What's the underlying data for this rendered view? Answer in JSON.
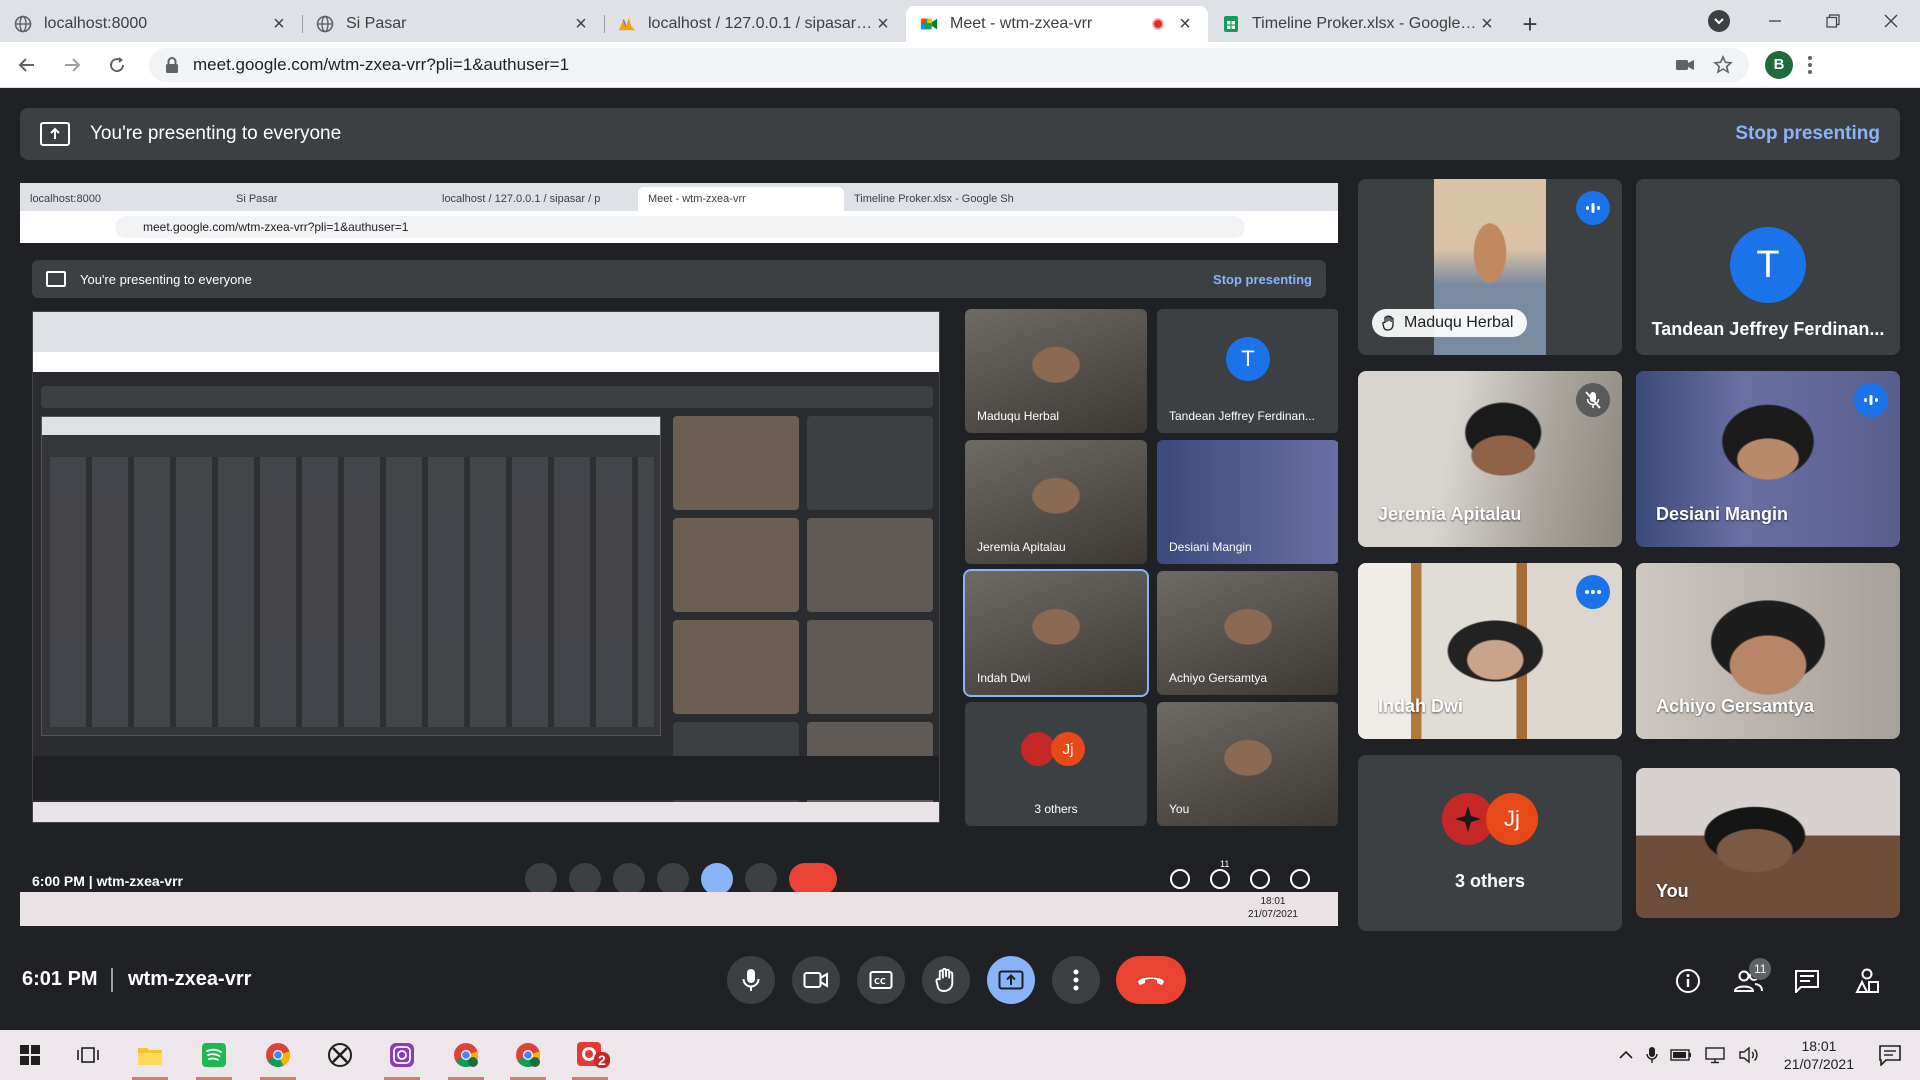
{
  "browser": {
    "tabs": [
      {
        "title": "localhost:8000",
        "active": false
      },
      {
        "title": "Si Pasar",
        "active": false
      },
      {
        "title": "localhost / 127.0.0.1 / sipasar / pr",
        "active": false
      },
      {
        "title": "Meet - wtm-zxea-vrr",
        "active": true
      },
      {
        "title": "Timeline Proker.xlsx - Google She",
        "active": false
      }
    ],
    "url": "meet.google.com/wtm-zxea-vrr?pli=1&authuser=1",
    "profile_initial": "B"
  },
  "banner": {
    "text": "You're presenting to everyone",
    "stop_label": "Stop presenting"
  },
  "shared_screen": {
    "tabs": [
      "localhost:8000",
      "Si Pasar",
      "localhost / 127.0.0.1 / sipasar / p",
      "Meet - wtm-zxea-vrr",
      "Timeline Proker.xlsx - Google Sh"
    ],
    "url": "meet.google.com/wtm-zxea-vrr?pli=1&authuser=1",
    "banner_text": "You're presenting to everyone",
    "stop_label": "Stop presenting",
    "tiles": [
      "Maduqu Herbal",
      "Tandean Jeffrey Ferdinan...",
      "Jeremia Apitalau",
      "Desiani Mangin",
      "Indah Dwi",
      "Achiyo Gersamtya",
      "3 others",
      "You"
    ],
    "tile_letter": "T",
    "others_initials": "Jj",
    "time": "6:00 PM",
    "meeting_code": "wtm-zxea-vrr",
    "people_count": "11",
    "clock_time": "18:01",
    "clock_date": "21/07/2021"
  },
  "participants": [
    {
      "name": "Maduqu Herbal",
      "speaking": true
    },
    {
      "name": "Tandean Jeffrey Ferdinan...",
      "initial": "T"
    },
    {
      "name": "Jeremia Apitalau",
      "muted": true
    },
    {
      "name": "Desiani Mangin",
      "speaking": true
    },
    {
      "name": "Indah Dwi",
      "options": true
    },
    {
      "name": "Achiyo Gersamtya"
    },
    {
      "name": "3 others",
      "initials": "Jj"
    },
    {
      "name": "You"
    }
  ],
  "meet_bar": {
    "time": "6:01 PM",
    "meeting_code": "wtm-zxea-vrr",
    "people_count": "11"
  },
  "taskbar": {
    "clock_time": "18:01",
    "clock_date": "21/07/2021",
    "chrome_badge": "2"
  },
  "colors": {
    "meet_bg": "#202124",
    "tile_bg": "#3c4043",
    "accent_blue": "#8ab4f8",
    "speaking_blue": "#1a73e8",
    "hangup_red": "#ea4335"
  }
}
